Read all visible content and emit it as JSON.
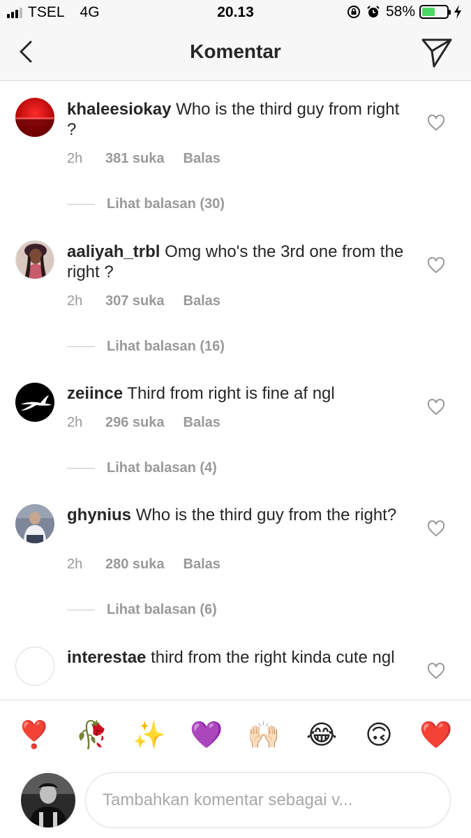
{
  "status_bar": {
    "carrier": "TSEL",
    "network": "4G",
    "time": "20.13",
    "battery": "58%",
    "battery_level": 0.58,
    "icons": [
      "rotation-lock-icon",
      "alarm-icon",
      "charging-bolt-icon"
    ]
  },
  "header": {
    "title": "Komentar",
    "back_icon": "back-chevron-icon",
    "share_icon": "send-direct-icon"
  },
  "comments": [
    {
      "username": "khaleesiokay",
      "text": "Who is the third guy from right ?",
      "time": "2h",
      "likes": "381 suka",
      "reply_label": "Balas",
      "view_replies": "Lihat balasan (30)"
    },
    {
      "username": "aaliyah_trbl",
      "text": "Omg who's the 3rd one from the right ?",
      "time": "2h",
      "likes": "307 suka",
      "reply_label": "Balas",
      "view_replies": "Lihat balasan (16)"
    },
    {
      "username": "zeiince",
      "text": "Third from right is fine af ngl",
      "time": "2h",
      "likes": "296 suka",
      "reply_label": "Balas",
      "view_replies": "Lihat balasan (4)"
    },
    {
      "username": "ghynius",
      "text": "Who is the third guy from the right?",
      "time": "2h",
      "likes": "280 suka",
      "reply_label": "Balas",
      "view_replies": "Lihat balasan (6)"
    },
    {
      "username": "interestae",
      "text": "third from the right kinda cute ngl"
    }
  ],
  "emoji_bar": [
    "❣️",
    "🥀",
    "✨",
    "💜",
    "🙌🏻",
    "😂",
    "🙃",
    "❤️"
  ],
  "composer": {
    "placeholder": "Tambahkan komentar sebagai v..."
  },
  "colors": {
    "text": "#262626",
    "muted": "#999999",
    "divider": "#dbdbdb",
    "bar_bg": "#f7f7f7",
    "battery_fill": "#4cd964"
  }
}
